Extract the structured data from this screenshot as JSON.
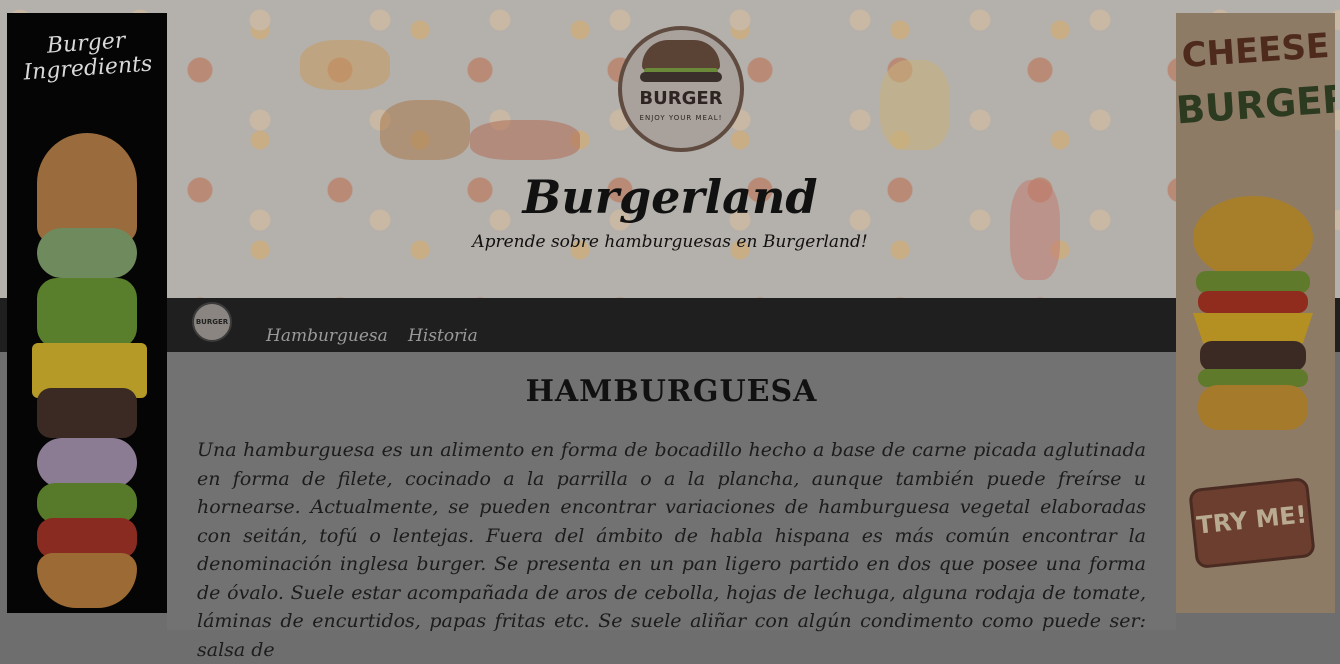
{
  "header": {
    "logo_text": "BURGER",
    "logo_subtext": "ENJOY YOUR MEAL!",
    "title": "Burgerland",
    "tagline": "Aprende sobre hamburguesas en Burgerland!"
  },
  "nav": {
    "logo_text": "BURGER",
    "items": [
      {
        "label": "Hamburguesa"
      },
      {
        "label": "Historia"
      }
    ]
  },
  "main": {
    "section_title": "HAMBURGUESA",
    "paragraph": "Una hamburguesa es un alimento en forma de bocadillo hecho a base de carne picada aglutinada en forma de filete, cocinado a la parrilla o a la plancha, aunque también puede freírse u hornearse. Actualmente, se pueden encontrar variaciones de hamburguesa vegetal elaboradas con seitán, tofú o lentejas. Fuera del ámbito de habla hispana es más común encontrar la denominación inglesa burger. Se presenta en un pan ligero partido en dos que posee una forma de óvalo. Suele estar acompañada de aros de cebolla, hojas de lechuga, alguna rodaja de tomate, láminas de encurtidos, papas fritas etc. Se suele aliñar con algún condimento como puede ser: salsa de"
  },
  "ads": {
    "left_title": "Burger Ingredients",
    "right_title_line1": "CHEESE",
    "right_title_line2": "BURGER",
    "right_cta": "TRY ME!"
  },
  "colors": {
    "nav_bg": "#1f1f1f",
    "overlay_gray": "#727272",
    "nav_text": "#9a9a9a"
  }
}
